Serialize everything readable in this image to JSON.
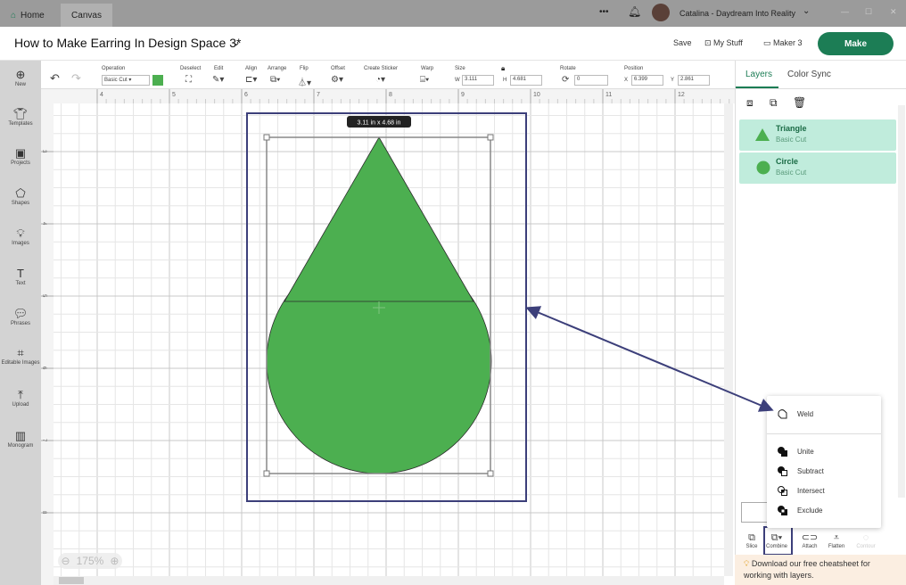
{
  "titlebar": {
    "tabs": [
      {
        "label": "Home"
      },
      {
        "label": "Canvas"
      }
    ],
    "more": "•••",
    "user": "Catalina - Daydream Into Reality"
  },
  "header": {
    "project_title": "How to Make Earring In Design Space 3*",
    "save": "Save",
    "my_stuff": "My Stuff",
    "machine": "Maker 3",
    "make": "Make"
  },
  "toolbar": {
    "operation_label": "Operation",
    "operation_value": "Basic Cut",
    "operation_color": "#4caf50",
    "deselect": "Deselect",
    "edit": "Edit",
    "align": "Align",
    "arrange": "Arrange",
    "flip": "Flip",
    "offset": "Offset",
    "create_sticker": "Create Sticker",
    "warp": "Warp",
    "size": "Size",
    "w_label": "W",
    "w": "3.111",
    "h_label": "H",
    "h": "4.681",
    "rotate": "Rotate",
    "rotate_value": "0",
    "position": "Position",
    "x_label": "X",
    "x": "6.399",
    "y_label": "Y",
    "y": "2.861"
  },
  "sidebar": {
    "items": [
      {
        "label": "New",
        "icon": "plus-circle"
      },
      {
        "label": "Templates",
        "icon": "shirt"
      },
      {
        "label": "Projects",
        "icon": "projects"
      },
      {
        "label": "Shapes",
        "icon": "shapes"
      },
      {
        "label": "Images",
        "icon": "lightbulb"
      },
      {
        "label": "Text",
        "icon": "text"
      },
      {
        "label": "Phrases",
        "icon": "speech"
      },
      {
        "label": "Editable Images",
        "icon": "editable"
      },
      {
        "label": "Upload",
        "icon": "upload"
      },
      {
        "label": "Monogram",
        "icon": "monogram"
      }
    ]
  },
  "canvas": {
    "ruler_x": [
      "4",
      "5",
      "6",
      "7",
      "8",
      "9",
      "10",
      "11",
      "12"
    ],
    "ruler_y": [
      "3",
      "4",
      "5",
      "6",
      "7",
      "8"
    ],
    "size_tooltip": "3.11  in x 4.68  in",
    "zoom": "175%",
    "shape_color": "#4caf50",
    "annotation_color": "#3c3f7a"
  },
  "panel": {
    "tabs": [
      "Layers",
      "Color Sync"
    ],
    "active_tab": "Layers",
    "layers": [
      {
        "name": "Triangle",
        "op": "Basic Cut",
        "icon": "triangle"
      },
      {
        "name": "Circle",
        "op": "Basic Cut",
        "icon": "circle"
      }
    ],
    "accent": "#c0ecdc"
  },
  "menu": {
    "items": [
      {
        "label": "Weld"
      },
      {
        "label": "Unite"
      },
      {
        "label": "Subtract"
      },
      {
        "label": "Intersect"
      },
      {
        "label": "Exclude"
      }
    ]
  },
  "bottom": {
    "buttons": [
      {
        "label": "Slice"
      },
      {
        "label": "Combine"
      },
      {
        "label": "Attach"
      },
      {
        "label": "Flatten"
      },
      {
        "label": "Contour"
      }
    ],
    "banner": "Download our free cheatsheet for working with layers."
  }
}
